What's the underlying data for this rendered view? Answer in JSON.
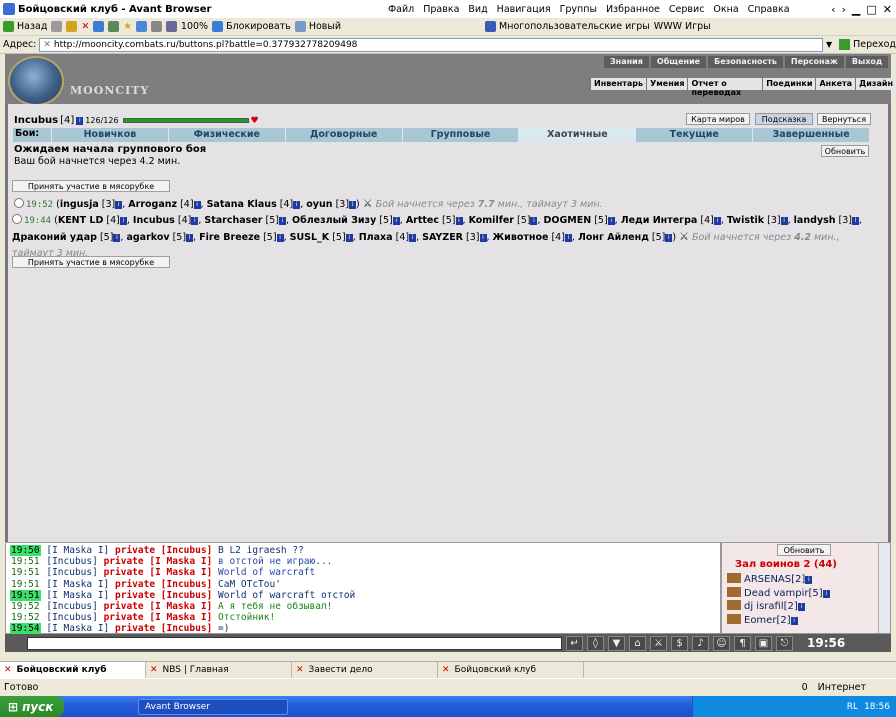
{
  "window": {
    "title": "Бойцовский клуб - Avant Browser",
    "menu": [
      "Файл",
      "Правка",
      "Вид",
      "Навигация",
      "Группы",
      "Избранное",
      "Сервис",
      "Окна",
      "Справка"
    ]
  },
  "toolbar": {
    "back": "Назад",
    "zoom": "100%",
    "block": "Блокировать",
    "new": "Новый",
    "multiuser": "Многопользовательские игры",
    "www": "WWW Игры"
  },
  "address": {
    "label": "Адрес:",
    "url": "http://mooncity.combats.ru/buttons.pl?battle=0.377932778209498",
    "go": "Переход"
  },
  "game": {
    "brand": "MOONCITY",
    "topnav": [
      "Знания",
      "Общение",
      "Безопасность",
      "Персонаж",
      "Выход"
    ],
    "subnav": [
      "Инвентарь",
      "Умения",
      "Отчет о переводах",
      "Поединки",
      "Анкета",
      "Дизайн"
    ],
    "player": {
      "name": "Incubus",
      "level": "[4]",
      "hp": "126/126",
      "hp_fraction": 1.0
    },
    "buttons": {
      "map": "Карта миров",
      "hint": "Подсказка",
      "back": "Вернуться",
      "refresh": "Обновить",
      "join": "Принять участие в мясорубке"
    },
    "tabs": {
      "label": "Бои:",
      "items": [
        "Новичков",
        "Физические",
        "Договорные",
        "Групповые",
        "Хаотичные",
        "Текущие",
        "Завершенные"
      ],
      "active": 4
    },
    "waiting_title": "Ожидаем начала группового боя",
    "waiting_sub": "Ваш бой начнется через 4.2 мин.",
    "bouts": [
      {
        "time": "19:52",
        "players": [
          {
            "n": "ingusja",
            "l": "[3]"
          },
          {
            "n": "Arroganz",
            "l": "[4]"
          },
          {
            "n": "Satana Klaus",
            "l": "[4]"
          },
          {
            "n": "oyun",
            "l": "[3]"
          }
        ],
        "info": "Бой начнется через ",
        "mins": "7.7",
        "info2": " мин., таймаут 3 мин."
      },
      {
        "time": "19:44",
        "players": [
          {
            "n": "KENT LD",
            "l": "[4]"
          },
          {
            "n": "Incubus",
            "l": "[4]"
          },
          {
            "n": "Starchaser",
            "l": "[5]"
          },
          {
            "n": "Облезлый Зизу",
            "l": "[5]"
          },
          {
            "n": "Arttec",
            "l": "[5]"
          },
          {
            "n": "Komilfer",
            "l": "[5]"
          },
          {
            "n": "DOGMEN",
            "l": "[5]"
          },
          {
            "n": "Леди Интегра",
            "l": "[4]"
          },
          {
            "n": "Twistik",
            "l": "[3]"
          },
          {
            "n": "landysh",
            "l": "[3]"
          },
          {
            "n": "Драконий удар",
            "l": "[5]"
          },
          {
            "n": "agarkov",
            "l": "[5]"
          },
          {
            "n": "Fire Breeze",
            "l": "[5]"
          },
          {
            "n": "SUSL_K",
            "l": "[5]"
          },
          {
            "n": "Плаха",
            "l": "[4]"
          },
          {
            "n": "SAYZER",
            "l": "[3]"
          },
          {
            "n": "Животное",
            "l": "[4]"
          },
          {
            "n": "Лонг Айленд",
            "l": "[5]"
          }
        ],
        "info": "Бой начнется через ",
        "mins": "4.2",
        "info2": " мин., таймаут 3 мин."
      }
    ]
  },
  "chat": [
    {
      "time": "19:50",
      "hl": true,
      "from": "[I Maska I]",
      "kw": "private",
      "to": "[Incubus]",
      "msg": "В L2 igraesh ??",
      "color": "navy"
    },
    {
      "time": "19:51",
      "hl": false,
      "from": "[Incubus]",
      "kw": "private",
      "to": "[I Maska I]",
      "msg": "в отстой не играю...",
      "color": "blue"
    },
    {
      "time": "19:51",
      "hl": false,
      "from": "[Incubus]",
      "kw": "private",
      "to": "[I Maska I]",
      "msg": "World of warcraft",
      "color": "blue"
    },
    {
      "time": "19:51",
      "hl": false,
      "from": "[I Maska I]",
      "kw": "private",
      "to": "[Incubus]",
      "msg": "CaM OTcTou'",
      "color": "navy"
    },
    {
      "time": "19:51",
      "hl": true,
      "from": "[I Maska I]",
      "kw": "private",
      "to": "[Incubus]",
      "msg": "World of warcraft отстой",
      "color": "navy"
    },
    {
      "time": "19:52",
      "hl": false,
      "from": "[Incubus]",
      "kw": "private",
      "to": "[I Maska I]",
      "msg": "А я тебя не обзывал!",
      "color": "green"
    },
    {
      "time": "19:52",
      "hl": false,
      "from": "[Incubus]",
      "kw": "private",
      "to": "[I Maska I]",
      "msg": "Отстойник!",
      "color": "green"
    },
    {
      "time": "19:54",
      "hl": true,
      "from": "[I Maska I]",
      "kw": "private",
      "to": "[Incubus]",
      "msg": "=)",
      "color": "navy"
    }
  ],
  "room": {
    "refresh": "Обновить",
    "name": "Зал воинов 2 (44)",
    "warriors": [
      {
        "n": "ARSENAS",
        "l": "[2]"
      },
      {
        "n": "Dead vampir",
        "l": "[5]"
      },
      {
        "n": "dj israfil",
        "l": "[2]"
      },
      {
        "n": "Eomer",
        "l": "[2]"
      }
    ]
  },
  "clock": "19:56",
  "browser_tabs": [
    {
      "label": "Бойцовский клуб",
      "active": true
    },
    {
      "label": "NBS | Главная",
      "active": false
    },
    {
      "label": "Завести дело",
      "active": false
    },
    {
      "label": "Бойцовский клуб",
      "active": false
    }
  ],
  "status": {
    "left": "Готово",
    "zone": "Интернет",
    "zero": "0"
  },
  "taskbar": {
    "start": "пуск",
    "app": "Avant Browser",
    "lang": "RL",
    "time": "18:56"
  }
}
